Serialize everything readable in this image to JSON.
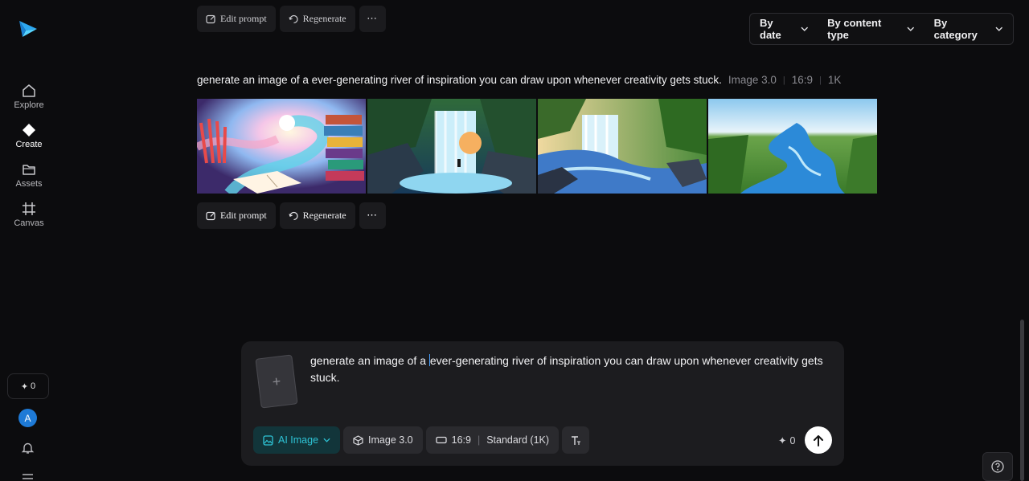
{
  "sidebar": {
    "items": [
      {
        "label": "Explore",
        "icon": "home-icon"
      },
      {
        "label": "Create",
        "icon": "sparkle-diamond-icon"
      },
      {
        "label": "Assets",
        "icon": "folder-icon"
      },
      {
        "label": "Canvas",
        "icon": "canvas-grid-icon"
      }
    ],
    "credits": "0",
    "avatar_letter": "A"
  },
  "filters": {
    "by_date": "By date",
    "by_content_type": "By content type",
    "by_category": "By category"
  },
  "history": {
    "actions": {
      "edit": "Edit prompt",
      "regenerate": "Regenerate"
    },
    "entry": {
      "prompt": "generate an image of a ever-generating river of inspiration you can draw upon whenever creativity gets stuck.",
      "model": "Image 3.0",
      "ratio": "16:9",
      "resolution": "1K"
    }
  },
  "composer": {
    "text_before_caret": "generate an image of a ",
    "text_after_caret": "ever-generating river of inspiration you can draw upon whenever creativity gets stuck.",
    "mode": "AI Image",
    "model": "Image 3.0",
    "ratio": "16:9",
    "quality": "Standard (1K)",
    "credit_cost": "0"
  },
  "colors": {
    "accent": "#2ec4d6",
    "avatar": "#1e7ad6"
  }
}
